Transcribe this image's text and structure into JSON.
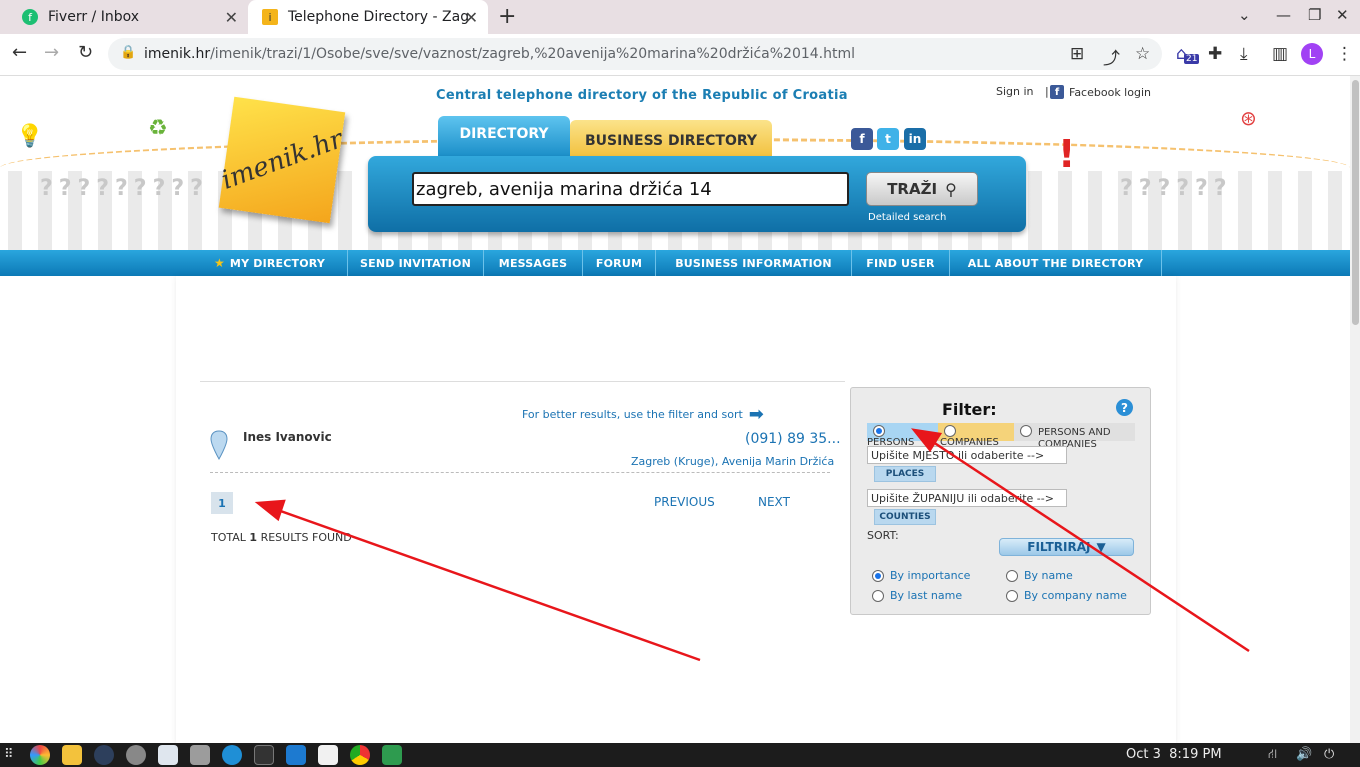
{
  "browser": {
    "tabs": [
      {
        "title": "Fiverr / Inbox"
      },
      {
        "title": "Telephone Directory - Zag"
      }
    ],
    "url_host": "imenik.hr",
    "url_path": "/imenik/trazi/1/Osobe/sve/sve/vaznost/zagreb,%20avenija%20marina%20držića%2014.html",
    "extension_badge": "21",
    "profile_initial": "L"
  },
  "header": {
    "logo_text": "imenik.hr",
    "tagline": "Central telephone directory of the Republic of Croatia",
    "sign_in": "Sign in",
    "separator": "|",
    "facebook_login": "Facebook login",
    "tab_directory": "DIRECTORY",
    "tab_business": "BUSINESS DIRECTORY",
    "search_value": "zagreb, avenija marina držića 14",
    "search_button": "TRAŽI",
    "detailed_search": "Detailed search"
  },
  "menu": [
    {
      "label": "MY DIRECTORY"
    },
    {
      "label": "SEND INVITATION"
    },
    {
      "label": "MESSAGES"
    },
    {
      "label": "FORUM"
    },
    {
      "label": "BUSINESS INFORMATION"
    },
    {
      "label": "FIND USER"
    },
    {
      "label": "ALL ABOUT THE DIRECTORY"
    }
  ],
  "results": {
    "hint": "For better results, use the filter and sort",
    "items": [
      {
        "name": "Ines Ivanovic",
        "phone": "(091) 89 35...",
        "address": "Zagreb (Kruge), Avenija Marin Držića"
      }
    ],
    "page": "1",
    "previous": "PREVIOUS",
    "next": "NEXT",
    "total_prefix": "TOTAL",
    "total_count": "1",
    "total_suffix": "RESULTS FOUND"
  },
  "filter": {
    "title": "Filter:",
    "help": "?",
    "tab_persons": "PERSONS",
    "tab_companies": "COMPANIES",
    "tab_both": "PERSONS AND COMPANIES",
    "place_value": "Upišite MJESTO ili odaberite -->",
    "places_button": "PLACES",
    "county_value": "Upišite ŽUPANIJU ili odaberite -->",
    "counties_button": "COUNTIES",
    "sort_label": "SORT:",
    "filter_button": "FILTRIRAJ",
    "sort_options": [
      {
        "label": "By importance",
        "selected": true
      },
      {
        "label": "By name",
        "selected": false
      },
      {
        "label": "By last name",
        "selected": false
      },
      {
        "label": "By company name",
        "selected": false
      }
    ]
  },
  "taskbar": {
    "date": "Oct 3",
    "time": "8:19 PM"
  }
}
